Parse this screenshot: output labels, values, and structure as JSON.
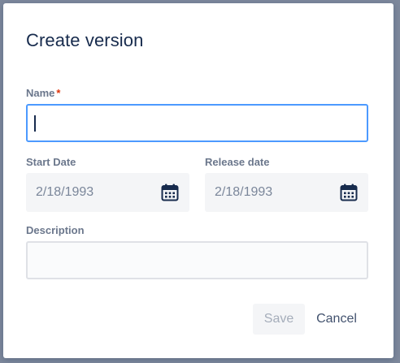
{
  "dialog": {
    "title": "Create version",
    "name": {
      "label": "Name",
      "required_marker": "*",
      "value": ""
    },
    "start_date": {
      "label": "Start Date",
      "value": "2/18/1993",
      "icon": "calendar-icon"
    },
    "release_date": {
      "label": "Release date",
      "value": "2/18/1993",
      "icon": "calendar-icon"
    },
    "description": {
      "label": "Description",
      "value": ""
    },
    "actions": {
      "save_label": "Save",
      "cancel_label": "Cancel"
    }
  },
  "colors": {
    "focus_border": "#4c9aff",
    "title": "#172b4d",
    "label": "#6b778c",
    "required": "#de350b",
    "disabled_text": "#a5adba"
  }
}
